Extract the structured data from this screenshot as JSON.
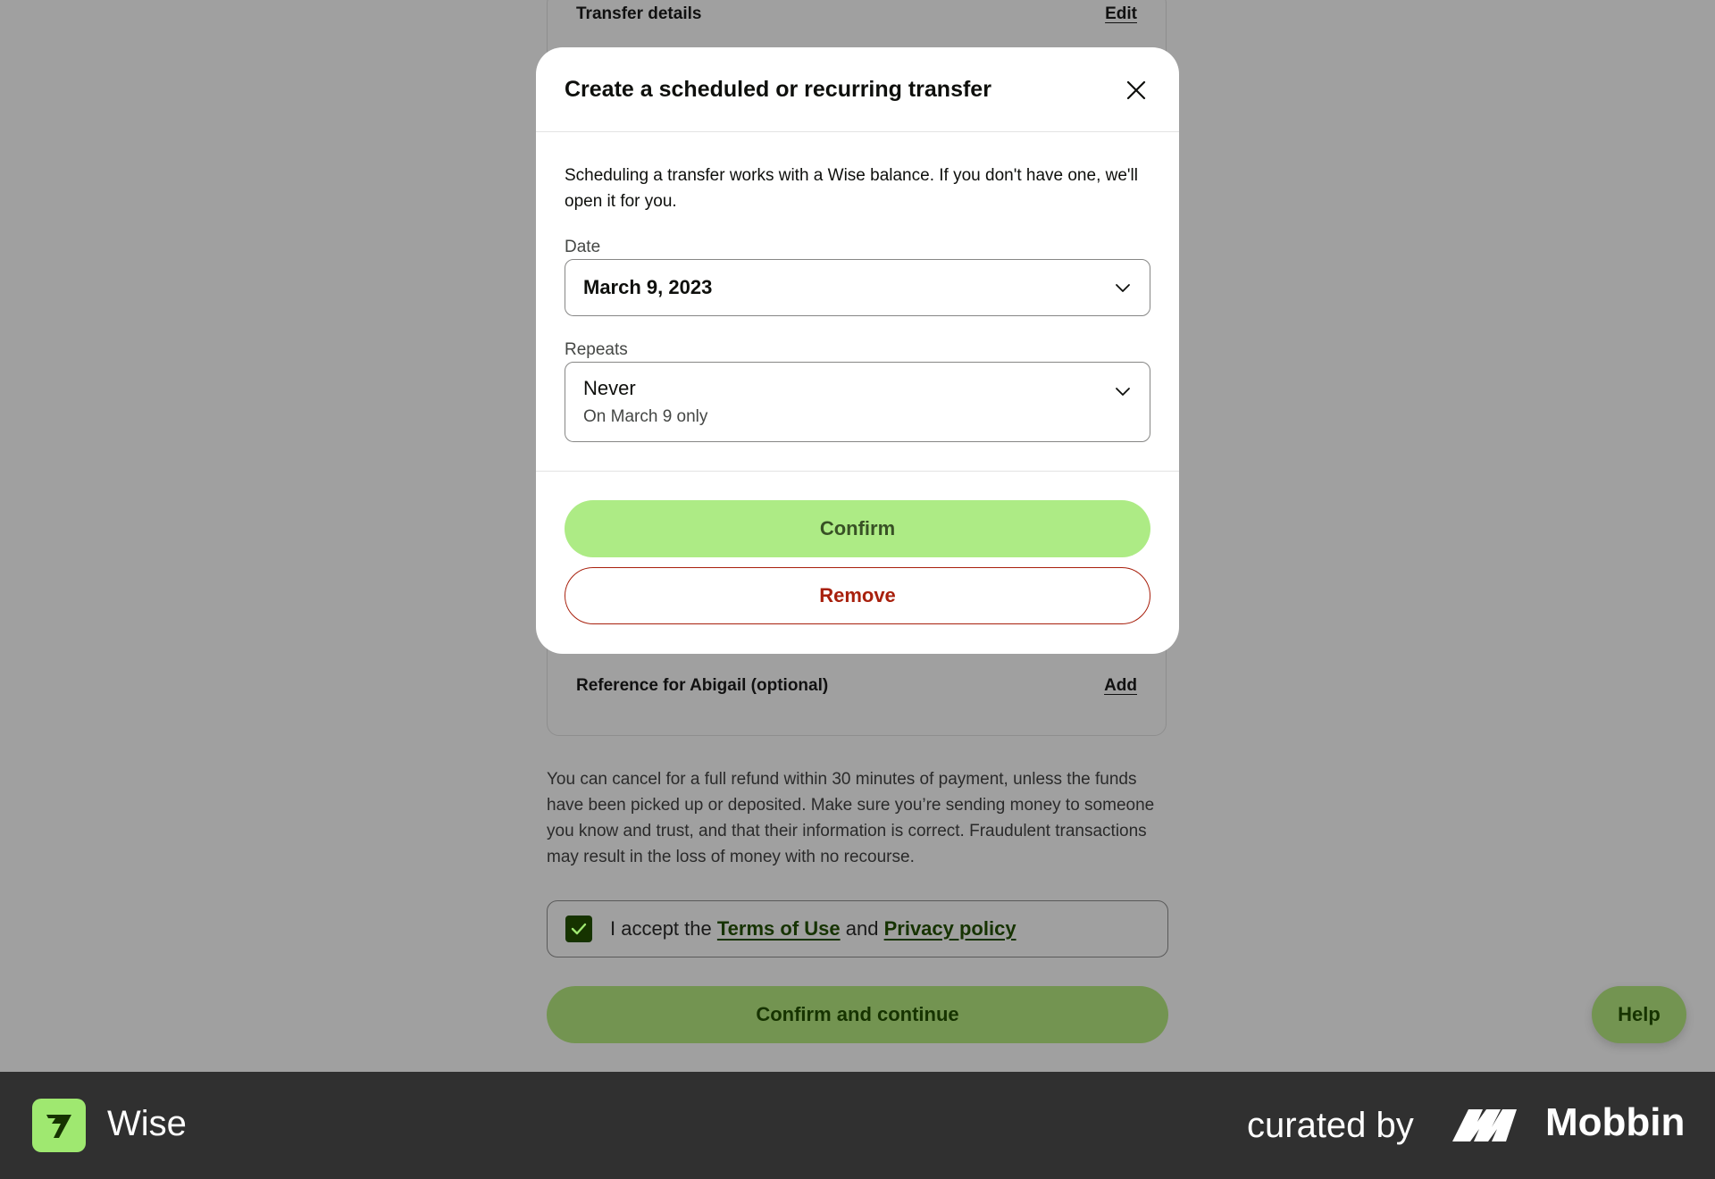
{
  "background": {
    "transfer_details_label": "Transfer details",
    "transfer_details_action": "Edit",
    "reference_label": "Reference for Abigail (optional)",
    "reference_action": "Add",
    "disclaimer": "You can cancel for a full refund within 30 minutes of payment, unless the funds have been picked up or deposited. Make sure you’re sending money to someone you know and trust, and that their information is correct. Fraudulent transactions may result in the loss of money with no recourse.",
    "terms": {
      "prefix": "I accept the",
      "terms_link": "Terms of Use",
      "conjunction": "and",
      "privacy_link": "Privacy policy",
      "checked": true
    },
    "continue_button": "Confirm and continue",
    "help_button": "Help"
  },
  "modal": {
    "title": "Create a scheduled or recurring transfer",
    "close_icon": "close-icon",
    "intro": "Scheduling a transfer works with a Wise balance. If you don't have one, we'll open it for you.",
    "date_label": "Date",
    "date_value": "March 9, 2023",
    "repeats_label": "Repeats",
    "repeats_value": "Never",
    "repeats_sub": "On March 9 only",
    "confirm_button": "Confirm",
    "remove_button": "Remove"
  },
  "footer": {
    "app_name": "Wise",
    "curated_by": "curated by",
    "brand": "Mobbin"
  },
  "colors": {
    "accent_green": "#9fe870",
    "dark_green": "#163300",
    "danger_red": "#a8200d",
    "overlay_gray": "#a0a0a0"
  }
}
